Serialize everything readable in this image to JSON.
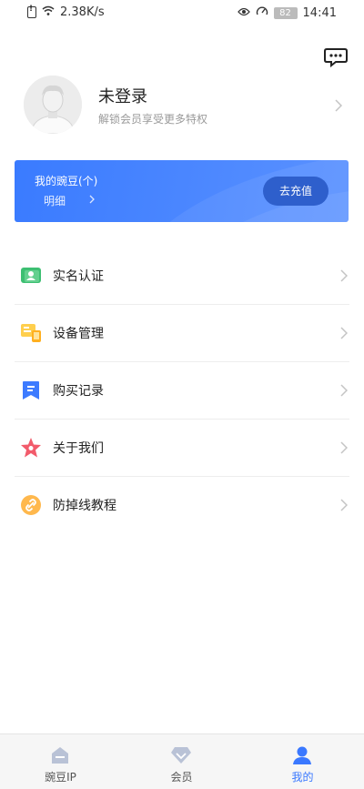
{
  "status_bar": {
    "speed": "2.38K/s",
    "battery": "82",
    "time": "14:41"
  },
  "profile": {
    "name": "未登录",
    "subtitle": "解锁会员享受更多特权"
  },
  "beans_card": {
    "title": "我的豌豆(个)",
    "detail": "明细",
    "recharge": "去充值"
  },
  "menu": {
    "items": [
      {
        "label": "实名认证",
        "icon": "id-card-icon"
      },
      {
        "label": "设备管理",
        "icon": "device-icon"
      },
      {
        "label": "购买记录",
        "icon": "bookmark-icon"
      },
      {
        "label": "关于我们",
        "icon": "star-icon"
      },
      {
        "label": "防掉线教程",
        "icon": "link-icon"
      }
    ]
  },
  "tabbar": {
    "tabs": [
      {
        "label": "豌豆IP"
      },
      {
        "label": "会员"
      },
      {
        "label": "我的"
      }
    ],
    "active_color": "#3a78ff"
  }
}
